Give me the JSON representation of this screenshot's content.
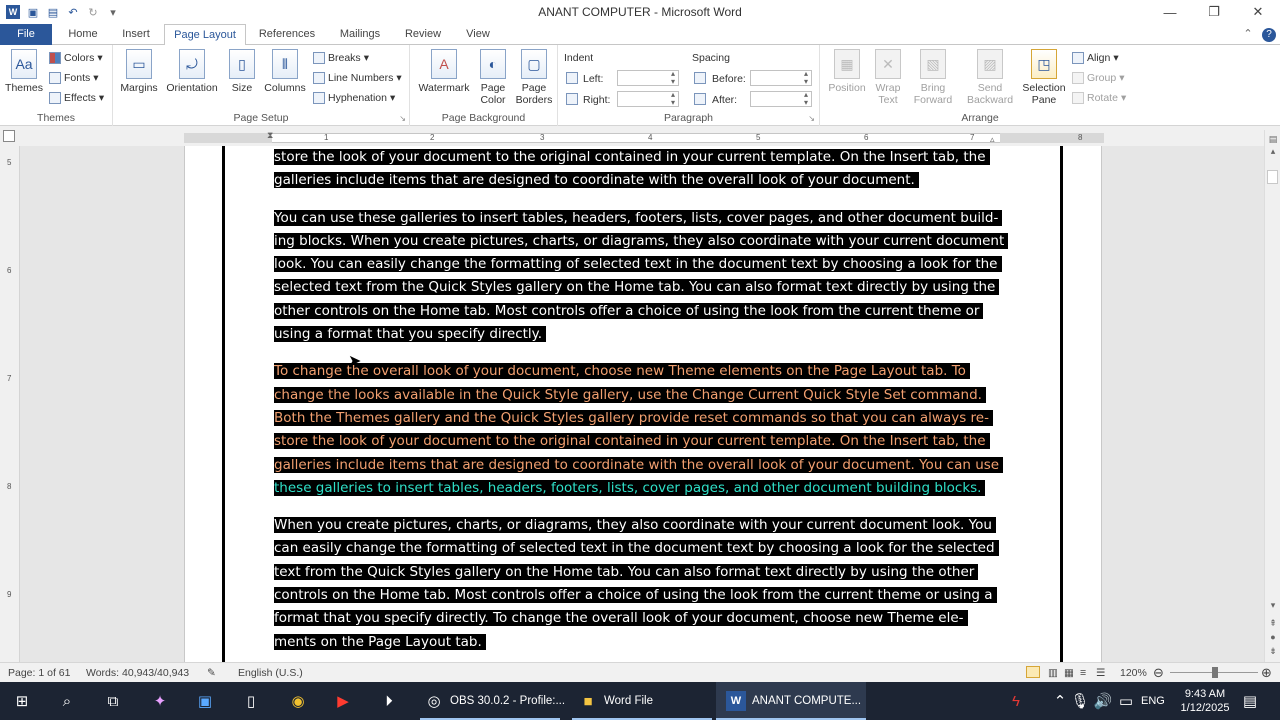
{
  "window": {
    "title": "ANANT COMPUTER  -  Microsoft Word",
    "minimize": "—",
    "restore": "❐",
    "close": "✕"
  },
  "tabs": [
    {
      "label": "File"
    },
    {
      "label": "Home"
    },
    {
      "label": "Insert"
    },
    {
      "label": "Page Layout"
    },
    {
      "label": "References"
    },
    {
      "label": "Mailings"
    },
    {
      "label": "Review"
    },
    {
      "label": "View"
    }
  ],
  "ribbon": {
    "themes": {
      "group": "Themes",
      "themes": "Themes",
      "colors": "Colors",
      "fonts": "Fonts",
      "effects": "Effects"
    },
    "page_setup": {
      "group": "Page Setup",
      "margins": "Margins",
      "orientation": "Orientation",
      "size": "Size",
      "columns": "Columns",
      "breaks": "Breaks",
      "line_numbers": "Line Numbers",
      "hyphenation": "Hyphenation"
    },
    "page_background": {
      "group": "Page Background",
      "watermark": "Watermark",
      "page_color_1": "Page",
      "page_color_2": "Color",
      "page_borders_1": "Page",
      "page_borders_2": "Borders"
    },
    "paragraph": {
      "group": "Paragraph",
      "indent": "Indent",
      "left": "Left:",
      "right": "Right:",
      "spacing": "Spacing",
      "before": "Before:",
      "after": "After:"
    },
    "arrange": {
      "group": "Arrange",
      "position": "Position",
      "wrap_1": "Wrap",
      "wrap_2": "Text",
      "bring_1": "Bring",
      "bring_2": "Forward",
      "send_1": "Send",
      "send_2": "Backward",
      "selection_1": "Selection",
      "selection_2": "Pane",
      "align": "Align",
      "group_btn": "Group",
      "rotate": "Rotate"
    }
  },
  "ruler": {
    "h_numbers": [
      "1",
      "1",
      "2",
      "3",
      "4",
      "5",
      "6",
      "7",
      "8"
    ],
    "v_numbers": [
      "5",
      "6",
      "7",
      "8",
      "9"
    ]
  },
  "document": {
    "paragraphs": [
      {
        "style": "white",
        "lines": [
          "store the look of your document to the original contained in your current template. On the Insert tab, the",
          "galleries include items that are designed to coordinate with the overall look of your document."
        ]
      },
      {
        "style": "white",
        "lines": [
          "You can use these galleries to insert tables, headers, footers, lists, cover pages, and other document build-",
          "ing blocks. When you create pictures, charts, or diagrams, they also coordinate with your current document",
          "look. You can easily change the formatting of selected text in the document text by choosing a look for the",
          "selected text from the Quick Styles gallery on the Home tab. You can also format text directly by using the",
          "other controls on the Home tab. Most controls offer a choice of using the look from the current theme or",
          "using a format that you specify directly."
        ]
      },
      {
        "style": "orange",
        "lines": [
          "To change the overall look of your document, choose new Theme elements on the Page Layout tab. To",
          "change the looks available in the Quick Style gallery, use the Change Current Quick Style Set command.",
          "Both the Themes gallery and the Quick Styles gallery provide reset commands so that you can always re-",
          "store the look of your document to the original contained in your current template. On the Insert tab, the",
          "galleries include items that are designed to coordinate with the overall look of your document. You can use"
        ],
        "extra_cyan_line": "these galleries to insert tables, headers, footers, lists, cover pages, and other document building blocks."
      },
      {
        "style": "white",
        "lines": [
          "When you create pictures, charts, or diagrams, they also coordinate with your current document look. You",
          "can easily change the formatting of selected text in the document text by choosing a look for the selected",
          "text from the Quick Styles gallery on the Home tab. You can also format text directly by using the other",
          "controls on the Home tab. Most controls offer a choice of using the look from the current theme or using a",
          "format that you specify directly. To change the overall look of your document, choose new Theme ele-",
          "ments on the Page Layout tab."
        ]
      }
    ]
  },
  "status": {
    "page": "Page: 1 of 61",
    "words": "Words: 40,943/40,943",
    "language": "English (U.S.)",
    "zoom": "120%"
  },
  "taskbar": {
    "apps": [
      {
        "label": "OBS 30.0.2 - Profile:..."
      },
      {
        "label": "Word File"
      },
      {
        "label": "ANANT COMPUTE..."
      }
    ],
    "lang": "ENG",
    "time": "9:43 AM",
    "date": "1/12/2025"
  },
  "colors": {
    "accent": "#2b579a",
    "taskbar": "#1c2433",
    "selection_bg": "#000000",
    "orange_text": "#f2a070",
    "cyan_text": "#2fe0c8"
  }
}
